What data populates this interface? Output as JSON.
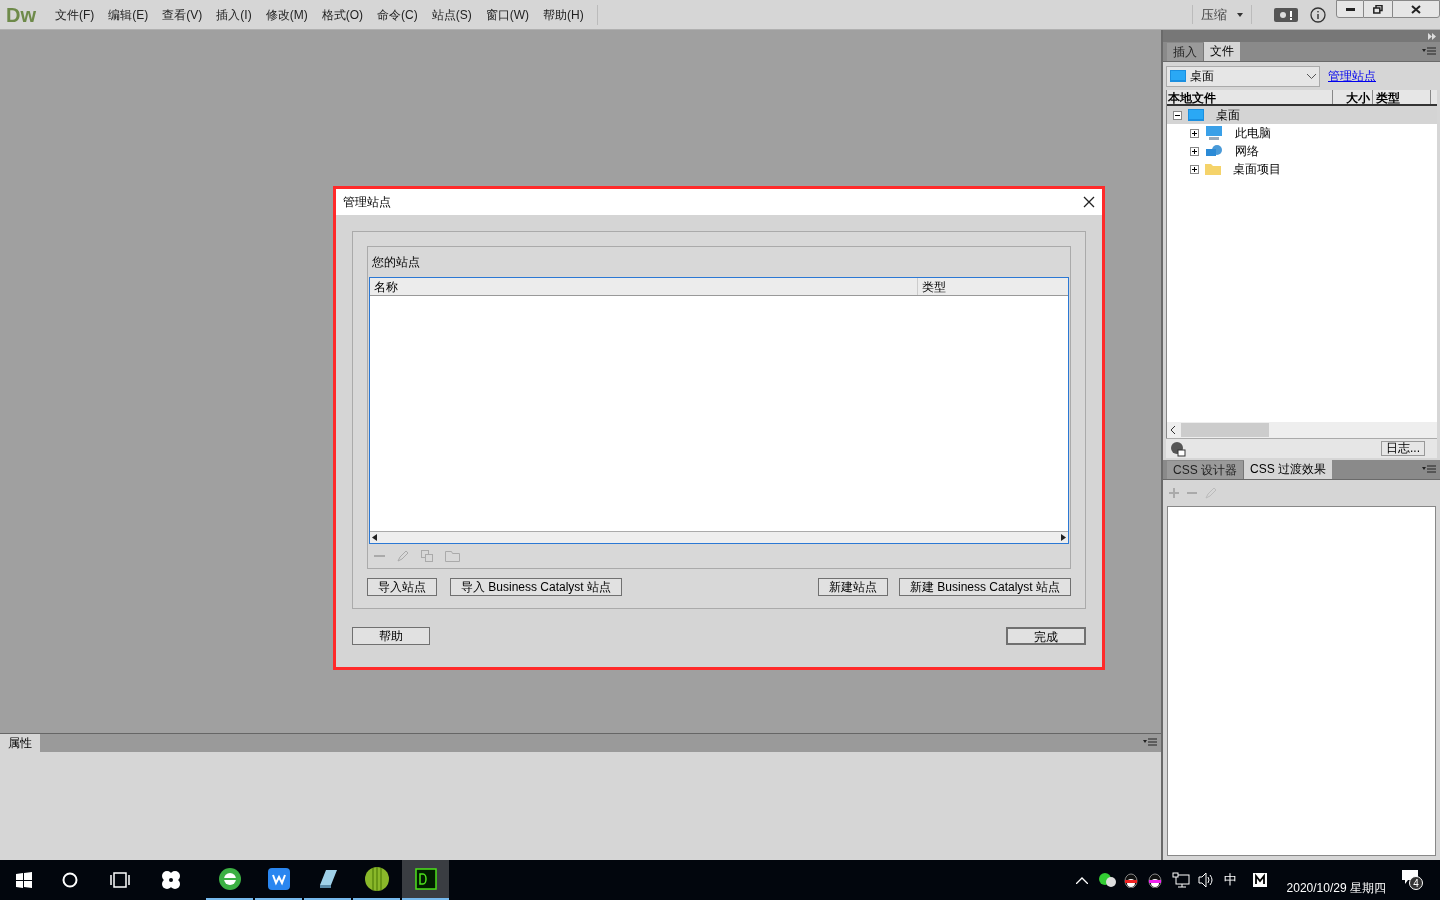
{
  "app": {
    "logo": "Dw",
    "menu": [
      "文件(F)",
      "编辑(E)",
      "查看(V)",
      "插入(I)",
      "修改(M)",
      "格式(O)",
      "命令(C)",
      "站点(S)",
      "窗口(W)",
      "帮助(H)"
    ],
    "compress": "压缩"
  },
  "dialog": {
    "title": "管理站点",
    "group_label": "您的站点",
    "columns": [
      "名称",
      "类型"
    ],
    "left_buttons": [
      "导入站点",
      "导入 Business Catalyst 站点"
    ],
    "right_buttons": [
      "新建站点",
      "新建 Business Catalyst 站点"
    ],
    "help": "帮助",
    "done": "完成"
  },
  "properties_panel": {
    "tabs": [
      {
        "label": "属性",
        "selected": true
      }
    ]
  },
  "files_panel": {
    "tabs": [
      {
        "label": "插入",
        "selected": false
      },
      {
        "label": "文件",
        "selected": true
      }
    ],
    "location": "桌面",
    "manage_link": "管理站点",
    "columns": [
      "本地文件",
      "大小",
      "类型"
    ],
    "tree": [
      {
        "label": "桌面",
        "kind": "desktop",
        "expanded": true,
        "selected": true,
        "children": [
          {
            "label": "此电脑",
            "kind": "computer",
            "expanded": false,
            "selected": false
          },
          {
            "label": "网络",
            "kind": "network",
            "expanded": false,
            "selected": false
          },
          {
            "label": "桌面项目",
            "kind": "folder",
            "expanded": false,
            "selected": false
          }
        ]
      }
    ],
    "log_button": "日志..."
  },
  "css_panel": {
    "tabs": [
      {
        "label": "CSS 设计器",
        "selected": false
      },
      {
        "label": "CSS 过渡效果",
        "selected": true
      }
    ]
  },
  "taskbar": {
    "apps": [
      {
        "kind": "browser",
        "active": false
      },
      {
        "kind": "wps",
        "active": false
      },
      {
        "kind": "notepad",
        "active": false
      },
      {
        "kind": "ball",
        "active": false
      },
      {
        "kind": "dw",
        "active": true
      }
    ],
    "ime": "中",
    "date": "2020/10/29 星期四",
    "notifications": "4"
  }
}
